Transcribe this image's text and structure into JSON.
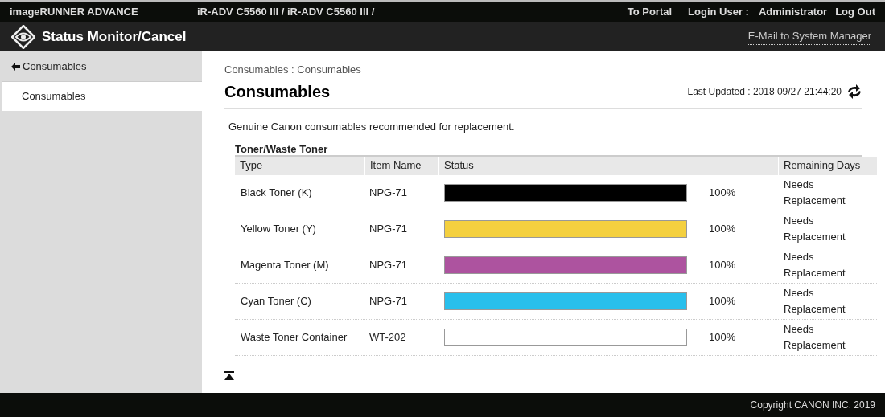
{
  "header": {
    "product": "imageRUNNER ADVANCE",
    "device": "iR-ADV C5560 III / iR-ADV C5560 III /",
    "links": [
      "To Portal"
    ],
    "login_label": "Login User :",
    "user": "Administrator",
    "logout": "Log Out"
  },
  "app_bar": {
    "title": "Status Monitor/Cancel",
    "email_link": "E-Mail to System Manager"
  },
  "sidebar": {
    "back": "Consumables",
    "items": [
      {
        "label": "Consumables",
        "selected": true
      }
    ]
  },
  "breadcrumb": "Consumables : Consumables",
  "heading": "Consumables",
  "last_updated": "Last Updated : 2018 09/27 21:44:20",
  "note": "Genuine Canon consumables recommended for replacement.",
  "table": {
    "caption": "Toner/Waste Toner",
    "columns": [
      "Type",
      "Item Name",
      "Status",
      "Remaining Days"
    ],
    "rows": [
      {
        "type": "Black Toner (K)",
        "item": "NPG-71",
        "level": 1,
        "color": "#000000",
        "percent": "100%",
        "remaining": "Needs Replacement"
      },
      {
        "type": "Yellow Toner (Y)",
        "item": "NPG-71",
        "level": 1,
        "color": "#f4d03f",
        "percent": "100%",
        "remaining": "Needs Replacement"
      },
      {
        "type": "Magenta Toner (M)",
        "item": "NPG-71",
        "level": 1,
        "color": "#ad539f",
        "percent": "100%",
        "remaining": "Needs Replacement"
      },
      {
        "type": "Cyan Toner (C)",
        "item": "NPG-71",
        "level": 1,
        "color": "#28bfec",
        "percent": "100%",
        "remaining": "Needs Replacement"
      },
      {
        "type": "Waste Toner Container",
        "item": "WT-202",
        "level": 1,
        "color": "#ffffff",
        "percent": "100%",
        "remaining": "Needs Replacement"
      }
    ]
  },
  "footer": "Copyright CANON INC. 2019"
}
